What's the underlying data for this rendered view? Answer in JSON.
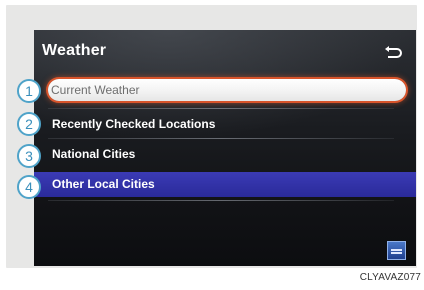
{
  "screen": {
    "title": "Weather",
    "back_icon": "return-arrow-icon",
    "logo_icon": "provider-logo-icon"
  },
  "menu": {
    "items": [
      {
        "number": "1",
        "label": "Current Weather",
        "state": "focused"
      },
      {
        "number": "2",
        "label": "Recently Checked Locations",
        "state": "normal"
      },
      {
        "number": "3",
        "label": "National Cities",
        "state": "normal"
      },
      {
        "number": "4",
        "label": "Other Local Cities",
        "state": "highlighted"
      }
    ]
  },
  "figure": {
    "code": "CLYAVAZ077"
  },
  "colors": {
    "focus_ring": "#d8542b",
    "highlight_row": "#2f2fa8",
    "callout_border": "#4fa3c9",
    "callout_text": "#3a8fbb"
  }
}
